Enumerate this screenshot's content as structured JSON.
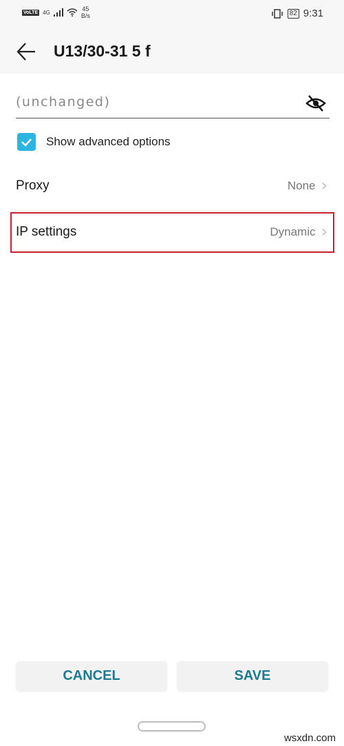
{
  "status_bar": {
    "network_badge": "VoLTE",
    "network_type": "4G",
    "speed_value": "45",
    "speed_unit": "B/s",
    "battery": "82",
    "time": "9:31"
  },
  "header": {
    "title": "U13/30-31 5 f"
  },
  "password": {
    "value": "(unchanged)"
  },
  "advanced": {
    "label": "Show advanced options",
    "checked": true,
    "accent": "#2bb5e0"
  },
  "rows": [
    {
      "label": "Proxy",
      "value": "None"
    },
    {
      "label": "IP settings",
      "value": "Dynamic"
    }
  ],
  "highlight_color": "#c8202e",
  "buttons": {
    "cancel": "CANCEL",
    "save": "SAVE"
  },
  "watermark": "wsxdn.com"
}
